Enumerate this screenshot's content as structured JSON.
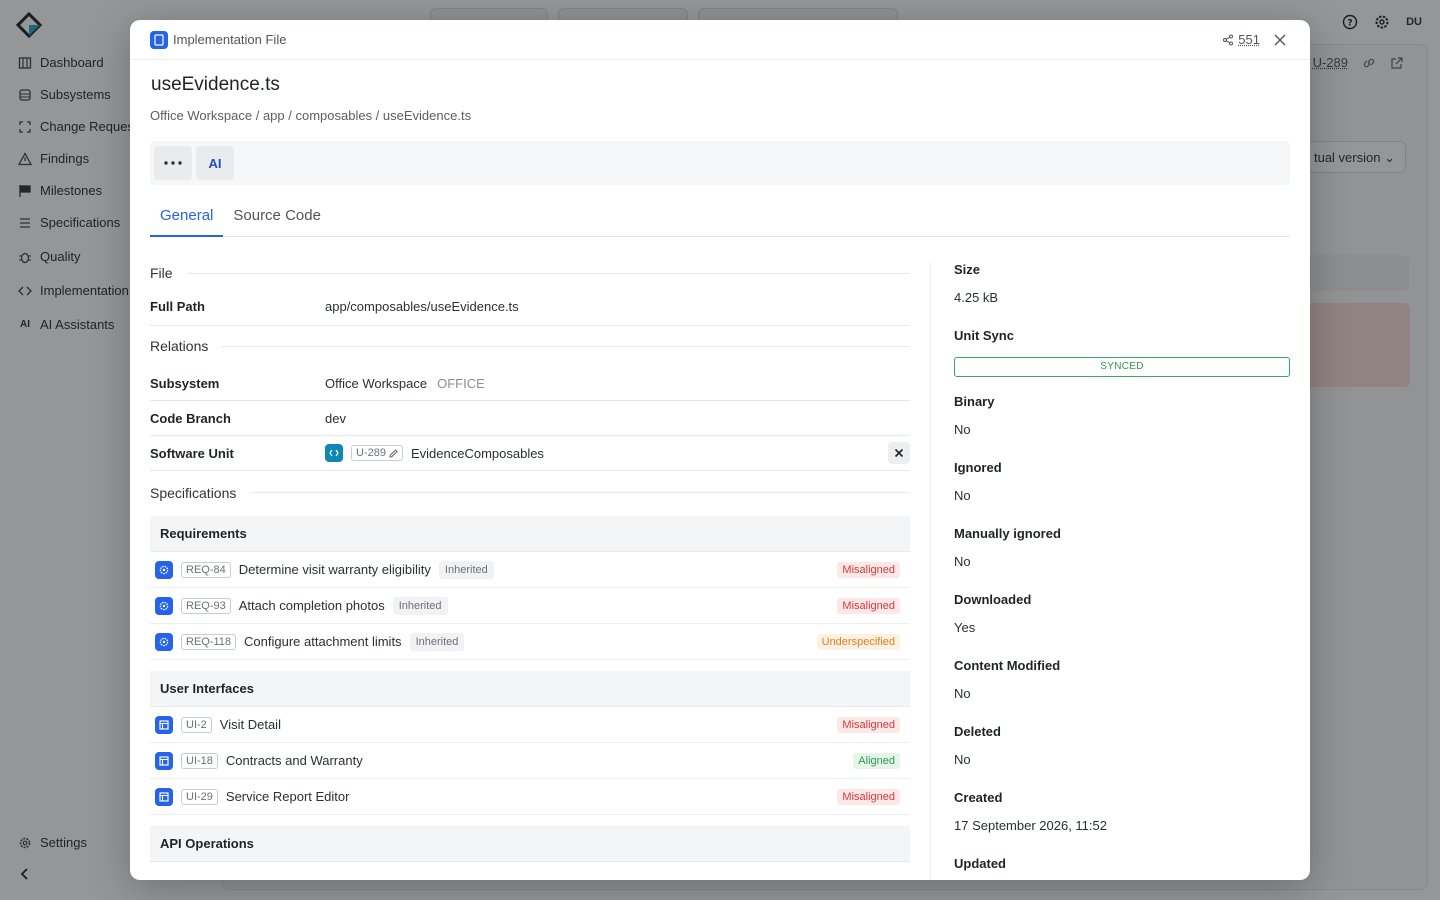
{
  "sidebar": {
    "items": [
      {
        "label": "Dashboard",
        "icon": "building-icon"
      },
      {
        "label": "Subsystems",
        "icon": "database-icon"
      },
      {
        "label": "Change Reques",
        "icon": "frame-icon"
      },
      {
        "label": "Findings",
        "icon": "warning-icon"
      },
      {
        "label": "Milestones",
        "icon": "flag-icon"
      },
      {
        "label": "Specifications",
        "icon": "list-icon"
      },
      {
        "label": "Quality",
        "icon": "bug-icon"
      },
      {
        "label": "Implementation",
        "icon": "code-icon"
      },
      {
        "label": "AI Assistants",
        "icon": "ai-icon"
      }
    ],
    "settings_label": "Settings"
  },
  "topbar": {
    "user_initials": "DU"
  },
  "background": {
    "ref_id": "U-289",
    "select_label": "tual version"
  },
  "modal": {
    "type_label": "Implementation File",
    "share_count": "551",
    "title": "useEvidence.ts",
    "breadcrumb": "Office Workspace / app / composables / useEvidence.ts",
    "toolbar": {
      "ai_label": "AI"
    },
    "tabs": [
      {
        "label": "General"
      },
      {
        "label": "Source Code"
      }
    ],
    "sections": {
      "file": "File",
      "relations": "Relations",
      "specifications": "Specifications"
    },
    "fields": {
      "full_path": {
        "label": "Full Path",
        "value": "app/composables/useEvidence.ts"
      },
      "subsystem": {
        "label": "Subsystem",
        "value": "Office Workspace",
        "code": "OFFICE"
      },
      "code_branch": {
        "label": "Code Branch",
        "value": "dev"
      },
      "software_unit": {
        "label": "Software Unit",
        "id": "U-289",
        "name": "EvidenceComposables"
      }
    },
    "groups": {
      "requirements": {
        "title": "Requirements",
        "items": [
          {
            "id": "REQ-84",
            "name": "Determine visit warranty eligibility",
            "inherited": "Inherited",
            "status": "Misaligned"
          },
          {
            "id": "REQ-93",
            "name": "Attach completion photos",
            "inherited": "Inherited",
            "status": "Misaligned"
          },
          {
            "id": "REQ-118",
            "name": "Configure attachment limits",
            "inherited": "Inherited",
            "status": "Underspecified"
          }
        ]
      },
      "user_interfaces": {
        "title": "User Interfaces",
        "items": [
          {
            "id": "UI-2",
            "name": "Visit Detail",
            "status": "Misaligned"
          },
          {
            "id": "UI-18",
            "name": "Contracts and Warranty",
            "status": "Aligned"
          },
          {
            "id": "UI-29",
            "name": "Service Report Editor",
            "status": "Misaligned"
          }
        ]
      },
      "api_operations": {
        "title": "API Operations"
      }
    },
    "properties": {
      "size": {
        "label": "Size",
        "value": "4.25 kB"
      },
      "unit_sync": {
        "label": "Unit Sync",
        "value": "SYNCED"
      },
      "binary": {
        "label": "Binary",
        "value": "No"
      },
      "ignored": {
        "label": "Ignored",
        "value": "No"
      },
      "manually_ignored": {
        "label": "Manually ignored",
        "value": "No"
      },
      "downloaded": {
        "label": "Downloaded",
        "value": "Yes"
      },
      "content_modified": {
        "label": "Content Modified",
        "value": "No"
      },
      "deleted": {
        "label": "Deleted",
        "value": "No"
      },
      "created": {
        "label": "Created",
        "value": "17 September 2026, 11:52"
      },
      "updated": {
        "label": "Updated"
      }
    }
  },
  "colors": {
    "accent": "#2563eb",
    "misaligned": "#d23b3b",
    "underspecified": "#e0801a",
    "aligned": "#2f9a4c"
  }
}
